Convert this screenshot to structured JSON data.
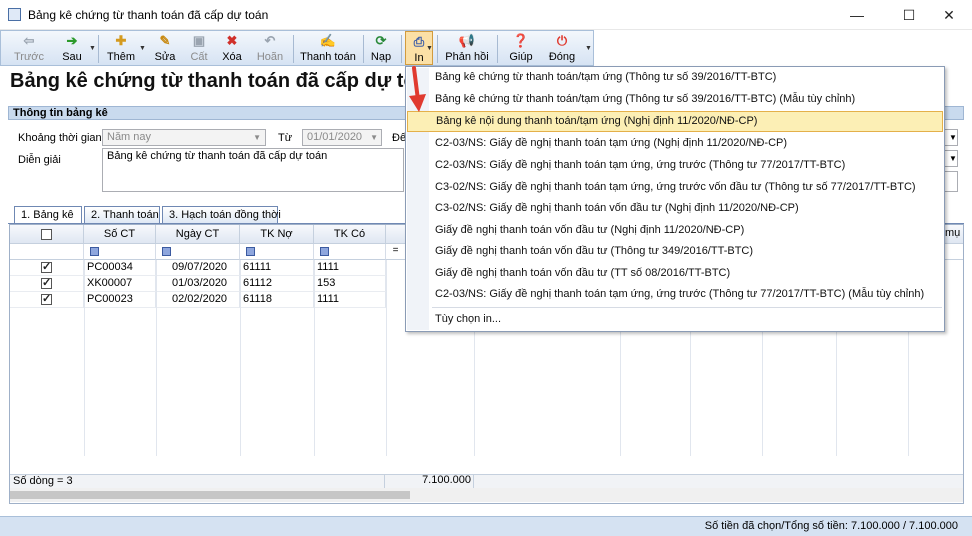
{
  "window": {
    "title": "Bảng kê chứng từ thanh toán đã cấp dự toán"
  },
  "toolbar": {
    "back": "Trước",
    "next": "Sau",
    "add": "Thêm",
    "edit": "Sửa",
    "cut": "Cất",
    "delete": "Xóa",
    "undo": "Hoãn",
    "pay": "Thanh toán",
    "load": "Nạp",
    "print": "In",
    "feedback": "Phản hồi",
    "help": "Giúp",
    "close": "Đóng"
  },
  "page": {
    "heading": "Bảng kê chứng từ thanh toán đã cấp dự to"
  },
  "section": {
    "title": "Thông tin bảng kê"
  },
  "form": {
    "period_label": "Khoảng thời gian",
    "period_value": "Năm nay",
    "from_label": "Từ",
    "from_value": "01/01/2020",
    "to_label": "Đế",
    "desc_label": "Diễn giải",
    "desc_value": "Bảng kê chứng từ thanh toán đã cấp dự toán"
  },
  "tabs": [
    "1. Bảng kê",
    "2. Thanh toán",
    "3. Hạch toán đồng thời"
  ],
  "grid": {
    "headers": [
      "Số CT",
      "Ngày CT",
      "TK Nợ",
      "TK Có"
    ],
    "right_header": "mụ",
    "rows": [
      {
        "checked": true,
        "so_ct": "PC00034",
        "ngay_ct": "09/07/2020",
        "tk_no": "61111",
        "tk_co": "1111"
      },
      {
        "checked": true,
        "so_ct": "XK00007",
        "ngay_ct": "01/03/2020",
        "tk_no": "61112",
        "tk_co": "153"
      },
      {
        "checked": true,
        "so_ct": "PC00023",
        "ngay_ct": "02/02/2020",
        "tk_no": "61118",
        "tk_co": "1111"
      }
    ],
    "row_count": "Số dòng = 3",
    "total": "7.100.000"
  },
  "status": {
    "text": "Số tiền đã chọn/Tổng số tiền: 7.100.000 / 7.100.000"
  },
  "print_menu": {
    "items": [
      "Bảng kê chứng từ thanh toán/tạm ứng (Thông tư số 39/2016/TT-BTC)",
      "Bảng kê chứng từ thanh toán/tạm ứng (Thông tư số 39/2016/TT-BTC) (Mẫu tùy chỉnh)",
      "Bảng kê nội dung thanh toán/tạm ứng (Nghị định 11/2020/NĐ-CP)",
      "C2-03/NS: Giấy đề nghị thanh toán tạm ứng (Nghị định 11/2020/NĐ-CP)",
      "C2-03/NS: Giấy đề nghị thanh toán tạm ứng, ứng trước (Thông tư 77/2017/TT-BTC)",
      "C3-02/NS: Giấy đề nghị thanh toán tạm ứng, ứng trước vốn đầu tư (Thông tư số 77/2017/TT-BTC)",
      "C3-02/NS: Giấy đề nghị thanh toán vốn đầu tư (Nghị định 11/2020/NĐ-CP)",
      "Giấy đề nghị thanh toán vốn đầu tư (Nghị định 11/2020/NĐ-CP)",
      "Giấy đề nghị thanh toán vốn đầu tư (Thông tư 349/2016/TT-BTC)",
      "Giấy đề nghị thanh toán vốn đầu tư (TT số 08/2016/TT-BTC)",
      "C2-03/NS: Giấy đề nghị thanh toán tạm ứng, ứng trước (Thông tư 77/2017/TT-BTC) (Mẫu tùy chỉnh)"
    ],
    "options": "Tùy chọn in...",
    "highlight_index": 2
  },
  "colors": {
    "toolbar": "#d6e3f3",
    "highlight": "#fcefb5",
    "accent_arrow": "#e03a2f"
  }
}
